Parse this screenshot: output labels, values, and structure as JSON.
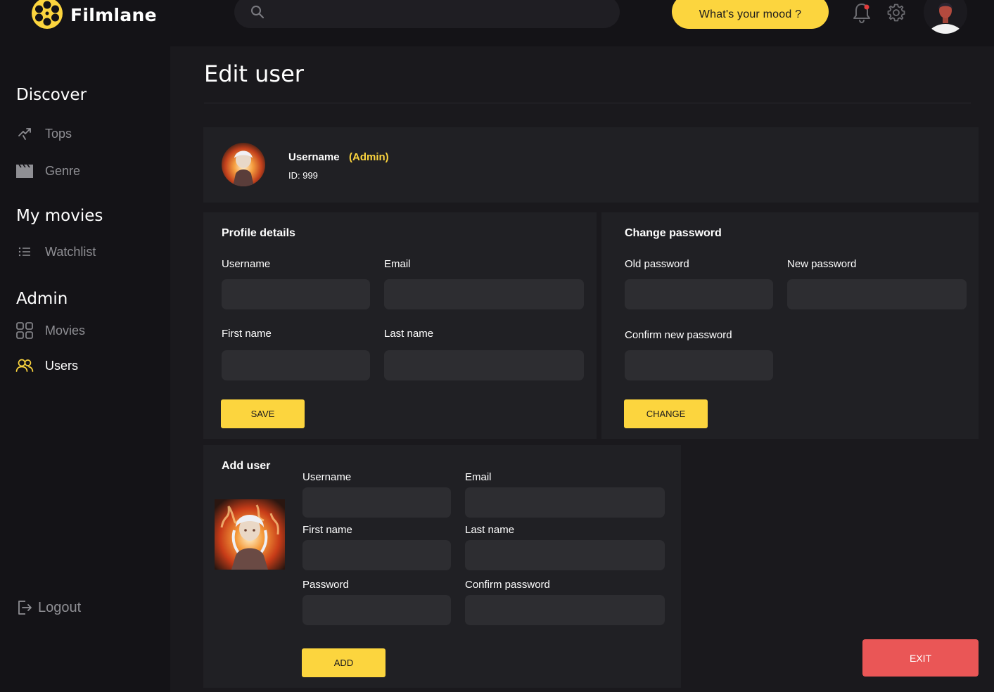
{
  "app": {
    "name": "Filmlane"
  },
  "header": {
    "search_placeholder": "",
    "mood_button": "What's your mood ?",
    "notification_dot_color": "#e23b3b"
  },
  "sidebar": {
    "sections": [
      {
        "heading": "Discover",
        "items": [
          {
            "label": "Tops",
            "icon": "trending-icon"
          },
          {
            "label": "Genre",
            "icon": "clapperboard-icon"
          }
        ]
      },
      {
        "heading": "My movies",
        "items": [
          {
            "label": "Watchlist",
            "icon": "list-icon"
          }
        ]
      },
      {
        "heading": "Admin",
        "items": [
          {
            "label": "Movies",
            "icon": "grid-icon"
          },
          {
            "label": "Users",
            "icon": "users-icon",
            "active": true
          }
        ]
      }
    ],
    "logout": "Logout"
  },
  "page": {
    "title": "Edit user"
  },
  "user_card": {
    "name": "Username",
    "role": "(Admin)",
    "id": "ID: 999"
  },
  "profile": {
    "title": "Profile details",
    "labels": {
      "username": "Username",
      "email": "Email",
      "first_name": "First name",
      "last_name": "Last name"
    },
    "save": "SAVE"
  },
  "password": {
    "title": "Change password",
    "labels": {
      "old": "Old password",
      "new": "New password",
      "confirm": "Confirm new password"
    },
    "change": "CHANGE"
  },
  "add_user": {
    "title": "Add user",
    "labels": {
      "username": "Username",
      "email": "Email",
      "first_name": "First name",
      "last_name": "Last name",
      "password": "Password",
      "confirm": "Confirm password"
    },
    "add": "ADD"
  },
  "exit": "EXIT",
  "colors": {
    "accent": "#fcd53e",
    "danger": "#ea5656",
    "panel": "#202024",
    "input": "#2d2d31"
  }
}
